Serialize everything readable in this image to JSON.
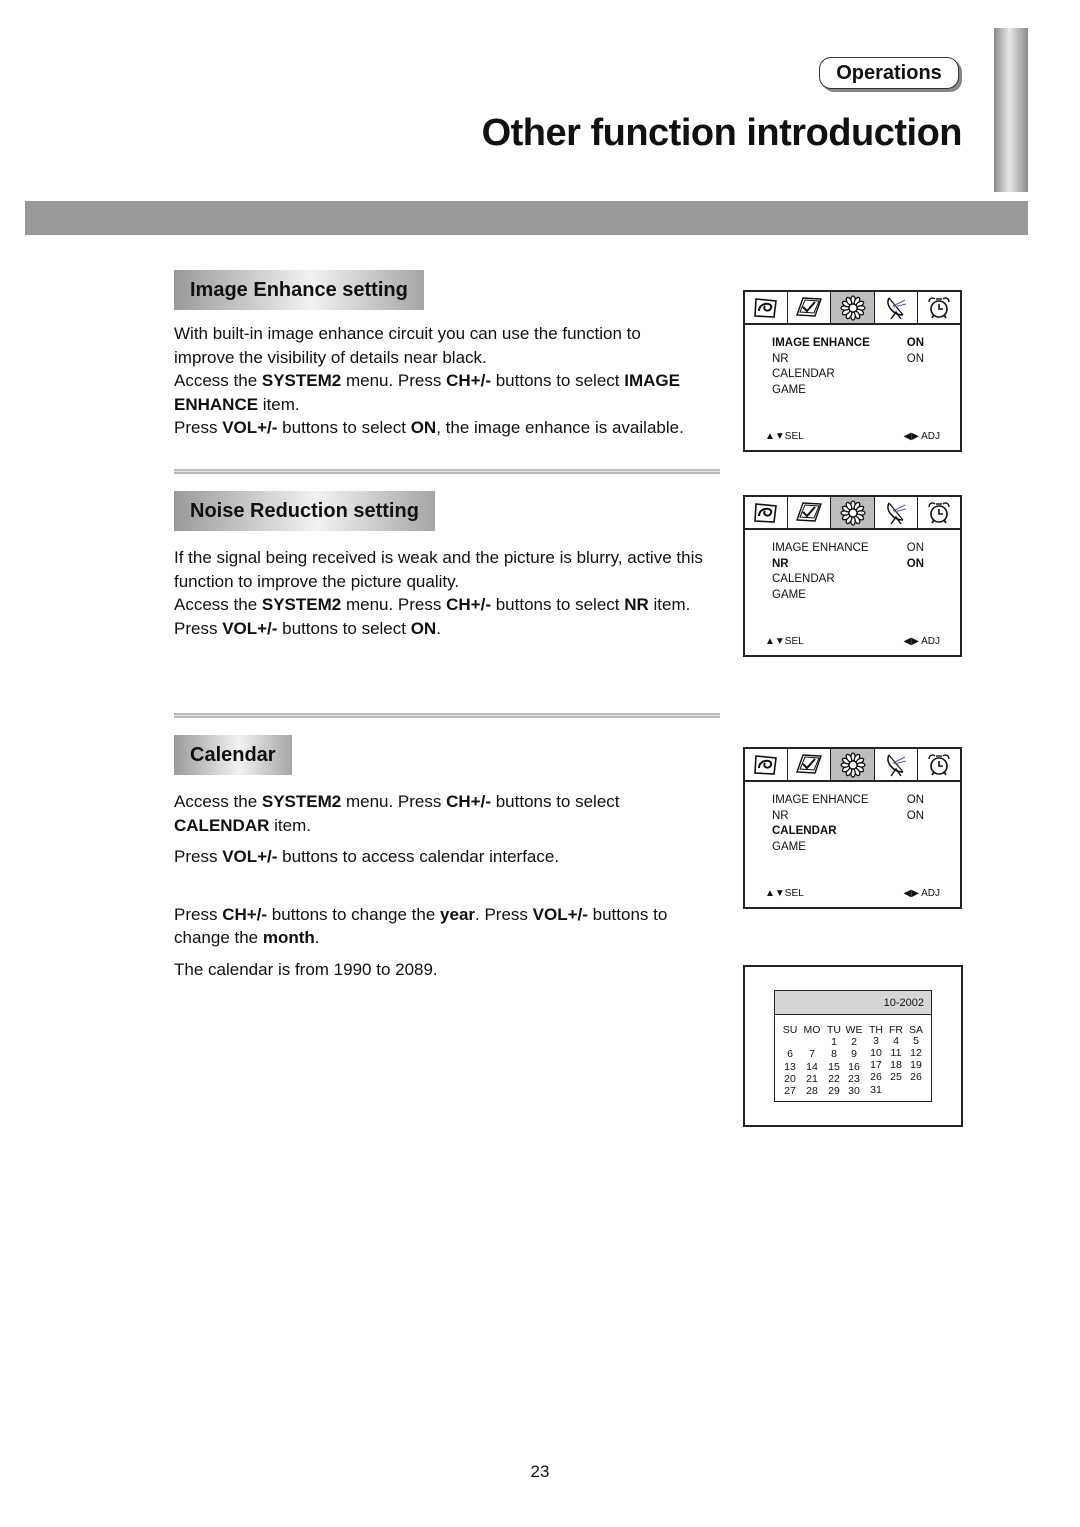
{
  "header": {
    "section_badge": "Operations",
    "page_title": "Other function introduction"
  },
  "sections": [
    {
      "heading": "Image Enhance setting",
      "paragraphs": [
        [
          {
            "t": "With built-in image enhance circuit you can use the function to improve the visibility of details near black."
          }
        ],
        [
          {
            "t": "Access the "
          },
          {
            "t": "SYSTEM2",
            "b": true
          },
          {
            "t": " menu. Press "
          },
          {
            "t": "CH+/-",
            "b": true
          },
          {
            "t": " buttons to select "
          },
          {
            "t": "IMAGE ENHANCE",
            "b": true
          },
          {
            "t": " item."
          }
        ],
        [
          {
            "t": "Press "
          },
          {
            "t": "VOL+/-",
            "b": true
          },
          {
            "t": " buttons to select "
          },
          {
            "t": "ON",
            "b": true
          },
          {
            "t": ", the image enhance is available."
          }
        ]
      ]
    },
    {
      "heading": "Noise Reduction setting",
      "paragraphs": [
        [
          {
            "t": "If the signal being received is weak and the picture is blurry, active this function to improve the picture quality."
          }
        ],
        [
          {
            "t": "Access the "
          },
          {
            "t": "SYSTEM2",
            "b": true
          },
          {
            "t": " menu. Press "
          },
          {
            "t": "CH+/-",
            "b": true
          },
          {
            "t": " buttons to select "
          },
          {
            "t": "NR",
            "b": true
          },
          {
            "t": " item."
          }
        ],
        [
          {
            "t": "Press "
          },
          {
            "t": "VOL+/-",
            "b": true
          },
          {
            "t": " buttons to select "
          },
          {
            "t": "ON",
            "b": true
          },
          {
            "t": "."
          }
        ]
      ]
    },
    {
      "heading": "Calendar",
      "paragraphs": [
        [
          {
            "t": "Access the "
          },
          {
            "t": "SYSTEM2",
            "b": true
          },
          {
            "t": " menu. Press "
          },
          {
            "t": "CH+/-",
            "b": true
          },
          {
            "t": " buttons to select "
          },
          {
            "t": "CALENDAR",
            "b": true
          },
          {
            "t": " item."
          }
        ],
        [
          {
            "t": "Press "
          },
          {
            "t": "VOL+/-",
            "b": true
          },
          {
            "t": " buttons to access calendar interface."
          }
        ],
        [
          {
            "t": "Press "
          },
          {
            "t": "CH+/-",
            "b": true
          },
          {
            "t": " buttons to change the "
          },
          {
            "t": "year",
            "b": true
          },
          {
            "t": ". Press "
          },
          {
            "t": "VOL+/-",
            "b": true
          },
          {
            "t": " buttons to change the "
          },
          {
            "t": "month",
            "b": true
          },
          {
            "t": "."
          }
        ],
        [
          {
            "t": "The calendar is from 1990 to 2089."
          }
        ]
      ]
    }
  ],
  "osd_menu": {
    "tab_icons": [
      "picture-icon",
      "checkmark-icon",
      "system-gear-icon",
      "satellite-dish-icon",
      "alarm-clock-icon"
    ],
    "active_tab": 2,
    "items": [
      {
        "label": "IMAGE ENHANCE",
        "value": "ON"
      },
      {
        "label": "NR",
        "value": "ON"
      },
      {
        "label": "CALENDAR",
        "value": ""
      },
      {
        "label": "GAME",
        "value": ""
      }
    ],
    "footer_left": "▲▼SEL",
    "footer_right": "◀▶ ADJ",
    "screens_selected": [
      0,
      1,
      2
    ]
  },
  "calendar": {
    "month_year": "10-2002",
    "weekdays": [
      "SU",
      "MO",
      "TU",
      "WE",
      "TH",
      "FR",
      "SA"
    ],
    "weeks": [
      [
        "",
        "",
        "1",
        "2",
        "3",
        "4",
        "5"
      ],
      [
        "6",
        "7",
        "8",
        "9",
        "10",
        "11",
        "12"
      ],
      [
        "13",
        "14",
        "15",
        "16",
        "17",
        "18",
        "19"
      ],
      [
        "20",
        "21",
        "22",
        "23",
        "26",
        "25",
        "26"
      ],
      [
        "27",
        "28",
        "29",
        "30",
        "31",
        "",
        ""
      ]
    ]
  },
  "footer": {
    "page_number": "23"
  }
}
